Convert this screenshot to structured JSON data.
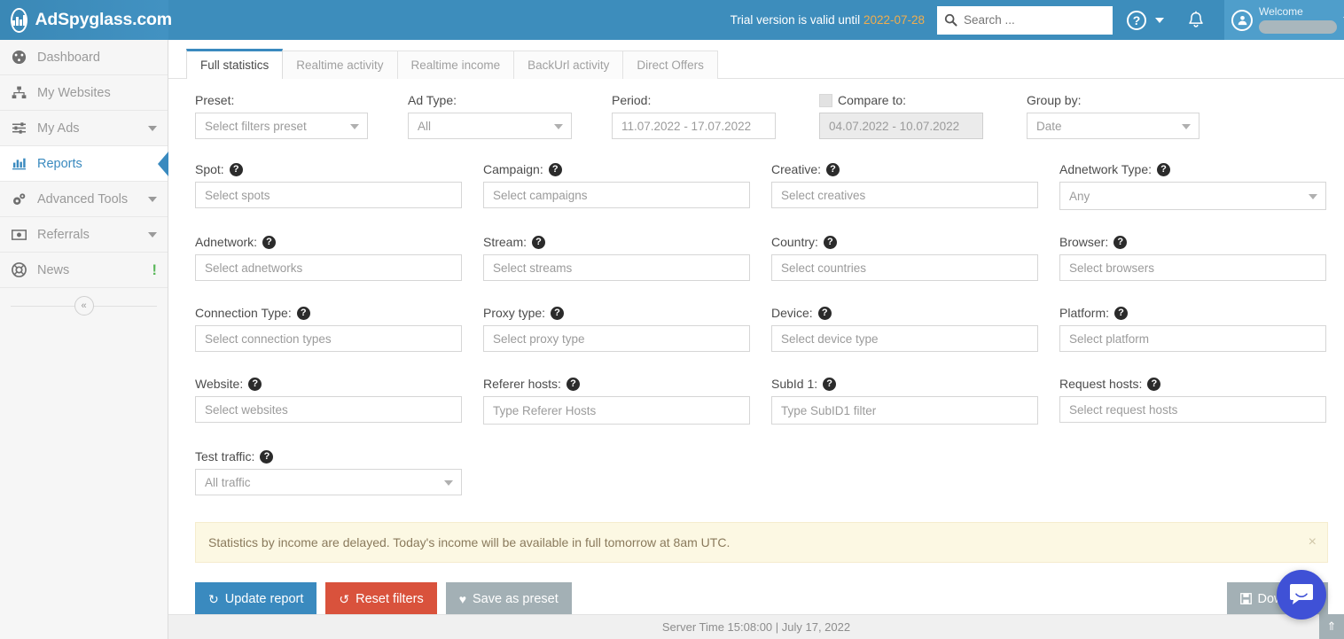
{
  "topbar": {
    "brand": "AdSpyglass.com",
    "brand_logo_icon": "bar-chart-circle-icon",
    "trial_prefix": "Trial version is valid until",
    "trial_date": "2022-07-28",
    "search_placeholder": "Search ...",
    "search_value": "",
    "search_icon": "search-icon",
    "help_icon": "question-circle-icon",
    "help_caret_icon": "chevron-down-icon",
    "bell_icon": "bell-icon",
    "avatar_icon": "user-circle-icon",
    "welcome_label": "Welcome",
    "user_name": "",
    "user_caret_icon": "chevron-down-icon",
    "accent": "#3d8dbc"
  },
  "sidebar": {
    "items": [
      {
        "label": "Dashboard",
        "icon": "dashboard-gauge-icon",
        "chevron": false,
        "badge": "",
        "active": false
      },
      {
        "label": "My Websites",
        "icon": "sitemap-icon",
        "chevron": false,
        "badge": "",
        "active": false
      },
      {
        "label": "My Ads",
        "icon": "sliders-icon",
        "chevron": true,
        "badge": "",
        "active": false
      },
      {
        "label": "Reports",
        "icon": "bar-chart-icon",
        "chevron": false,
        "badge": "",
        "active": true
      },
      {
        "label": "Advanced Tools",
        "icon": "gears-icon",
        "chevron": true,
        "badge": "",
        "active": false
      },
      {
        "label": "Referrals",
        "icon": "money-bill-icon",
        "chevron": true,
        "badge": "",
        "active": false
      },
      {
        "label": "News",
        "icon": "lifebuoy-icon",
        "chevron": false,
        "badge": "!",
        "active": false
      }
    ],
    "collapse_label": "«",
    "collapse_icon": "chevron-double-left-icon",
    "active_color": "#3a8abf",
    "badge_color": "#5cb85c"
  },
  "tabs": [
    {
      "label": "Full statistics",
      "active": true
    },
    {
      "label": "Realtime activity",
      "active": false
    },
    {
      "label": "Realtime income",
      "active": false
    },
    {
      "label": "BackUrl activity",
      "active": false
    },
    {
      "label": "Direct Offers",
      "active": false
    }
  ],
  "filters": {
    "row1": [
      {
        "name": "preset",
        "label": "Preset:",
        "help": false,
        "type": "select",
        "value": "Select filters preset",
        "disabled": false,
        "width": "w-195"
      },
      {
        "name": "ad-type",
        "label": "Ad Type:",
        "help": false,
        "type": "select",
        "value": "All",
        "disabled": false,
        "width": "w-185"
      },
      {
        "name": "period",
        "label": "Period:",
        "help": false,
        "type": "text",
        "value": "11.07.2022 - 17.07.2022",
        "disabled": false,
        "width": "w-185"
      },
      {
        "name": "compare-to",
        "label": "Compare to:",
        "help": false,
        "type": "text",
        "value": "04.07.2022 - 10.07.2022",
        "disabled": true,
        "width": "w-185",
        "checkbox": true
      },
      {
        "name": "group-by",
        "label": "Group by:",
        "help": false,
        "type": "select",
        "value": "Date",
        "disabled": false,
        "width": "w-195"
      }
    ],
    "row2": [
      {
        "name": "spot",
        "label": "Spot:",
        "help": true,
        "type": "tags",
        "value": "Select spots",
        "width": "w-300"
      },
      {
        "name": "campaign",
        "label": "Campaign:",
        "help": true,
        "type": "tags",
        "value": "Select campaigns",
        "width": "w-300"
      },
      {
        "name": "creative",
        "label": "Creative:",
        "help": true,
        "type": "tags",
        "value": "Select creatives",
        "width": "w-300"
      },
      {
        "name": "adnetwork-type",
        "label": "Adnetwork Type:",
        "help": true,
        "type": "select",
        "value": "Any",
        "width": "w-300"
      }
    ],
    "row3": [
      {
        "name": "adnetwork",
        "label": "Adnetwork:",
        "help": true,
        "type": "tags",
        "value": "Select adnetworks",
        "width": "w-300"
      },
      {
        "name": "stream",
        "label": "Stream:",
        "help": true,
        "type": "tags",
        "value": "Select streams",
        "width": "w-300"
      },
      {
        "name": "country",
        "label": "Country:",
        "help": true,
        "type": "tags",
        "value": "Select countries",
        "width": "w-300"
      },
      {
        "name": "browser",
        "label": "Browser:",
        "help": true,
        "type": "tags",
        "value": "Select browsers",
        "width": "w-300"
      }
    ],
    "row4": [
      {
        "name": "connection-type",
        "label": "Connection Type:",
        "help": true,
        "type": "tags",
        "value": "Select connection types",
        "width": "w-300"
      },
      {
        "name": "proxy-type",
        "label": "Proxy type:",
        "help": true,
        "type": "tags",
        "value": "Select proxy type",
        "width": "w-300"
      },
      {
        "name": "device",
        "label": "Device:",
        "help": true,
        "type": "tags",
        "value": "Select device type",
        "width": "w-300"
      },
      {
        "name": "platform",
        "label": "Platform:",
        "help": true,
        "type": "tags",
        "value": "Select platform",
        "width": "w-300"
      }
    ],
    "row5": [
      {
        "name": "website",
        "label": "Website:",
        "help": true,
        "type": "tags",
        "value": "Select websites",
        "width": "w-300"
      },
      {
        "name": "referer-hosts",
        "label": "Referer hosts:",
        "help": true,
        "type": "input",
        "value": "Type Referer Hosts",
        "width": "w-300"
      },
      {
        "name": "subid-1",
        "label": "SubId 1:",
        "help": true,
        "type": "input",
        "value": "Type SubID1 filter",
        "width": "w-300"
      },
      {
        "name": "request-hosts",
        "label": "Request hosts:",
        "help": true,
        "type": "tags",
        "value": "Select request hosts",
        "width": "w-300"
      }
    ],
    "row6": [
      {
        "name": "test-traffic",
        "label": "Test traffic:",
        "help": true,
        "type": "select",
        "value": "All traffic",
        "width": "w-300"
      }
    ],
    "help_icon": "question-mark-circle-icon"
  },
  "alert": {
    "text": "Statistics by income are delayed. Today's income will be available in full tomorrow at 8am UTC.",
    "close_label": "×",
    "close_icon": "close-icon",
    "background": "#fcf8e3"
  },
  "actions": {
    "update": {
      "label": "Update report",
      "icon": "refresh-icon",
      "glyph": "↻",
      "color": "#3a8abf"
    },
    "reset": {
      "label": "Reset filters",
      "icon": "undo-icon",
      "glyph": "↺",
      "color": "#d9523c"
    },
    "save": {
      "label": "Save as preset",
      "icon": "heart-icon",
      "glyph": "♥",
      "color": "#a3b0b5"
    },
    "download": {
      "label": "Download",
      "icon": "floppy-disk-icon",
      "glyph": "💾",
      "color": "#a3b0b5"
    }
  },
  "footer": {
    "text": "Server Time 15:08:00 | July 17, 2022",
    "scroll_top_label": "»",
    "scroll_top_icon": "chevron-double-up-icon"
  },
  "chat": {
    "icon": "chat-bubble-icon",
    "color": "#3f51d6"
  }
}
